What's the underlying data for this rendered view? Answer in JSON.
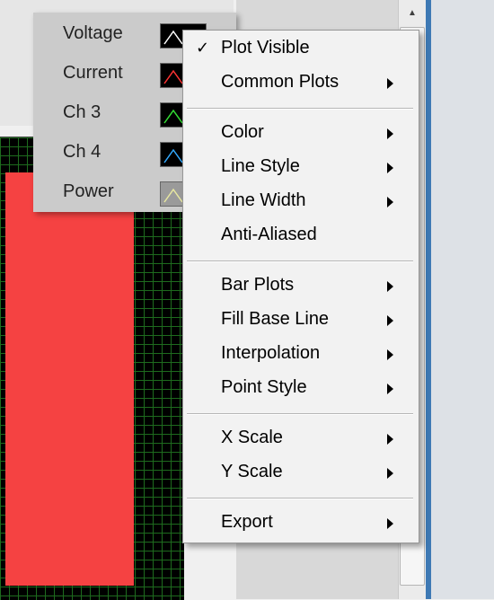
{
  "legend": {
    "items": [
      {
        "label": "Voltage",
        "color": "#ffffff"
      },
      {
        "label": "Current",
        "color": "#ff3333"
      },
      {
        "label": "Ch 3",
        "color": "#33dd33"
      },
      {
        "label": "Ch 4",
        "color": "#33aaff"
      },
      {
        "label": "Power",
        "color": "#e8e8a0"
      }
    ]
  },
  "menu": {
    "check_glyph": "✓",
    "items": [
      {
        "label": "Plot Visible",
        "checked": true,
        "submenu": false
      },
      {
        "label": "Common Plots",
        "checked": false,
        "submenu": true
      },
      {
        "label": "Color",
        "checked": false,
        "submenu": true
      },
      {
        "label": "Line Style",
        "checked": false,
        "submenu": true
      },
      {
        "label": "Line Width",
        "checked": false,
        "submenu": true
      },
      {
        "label": "Anti-Aliased",
        "checked": false,
        "submenu": false
      },
      {
        "label": "Bar Plots",
        "checked": false,
        "submenu": true
      },
      {
        "label": "Fill Base Line",
        "checked": false,
        "submenu": true
      },
      {
        "label": "Interpolation",
        "checked": false,
        "submenu": true
      },
      {
        "label": "Point Style",
        "checked": false,
        "submenu": true
      },
      {
        "label": "X Scale",
        "checked": false,
        "submenu": true
      },
      {
        "label": "Y Scale",
        "checked": false,
        "submenu": true
      },
      {
        "label": "Export",
        "checked": false,
        "submenu": true
      }
    ]
  },
  "scrollbar": {
    "up_glyph": "▲"
  },
  "colors": {
    "graph_bg": "#000000",
    "grid": "#1e6b1e",
    "fill": "#f54242",
    "accent": "#3e79b4"
  }
}
